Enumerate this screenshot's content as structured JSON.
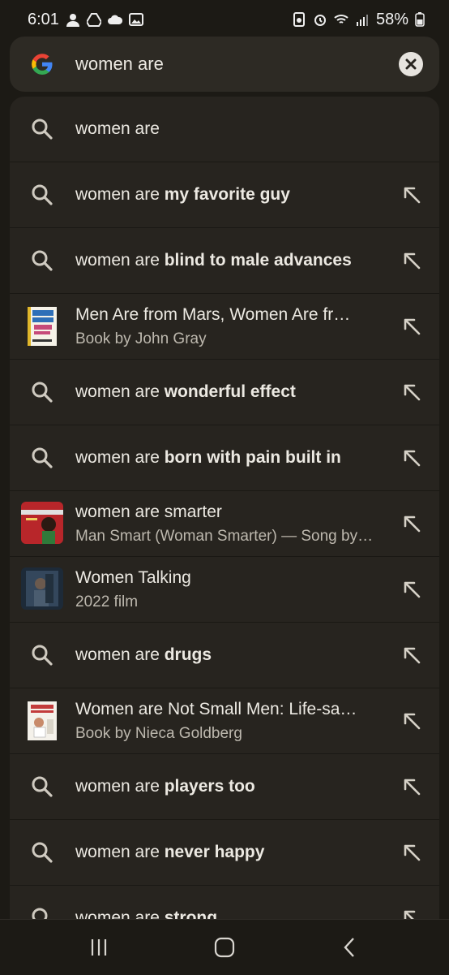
{
  "status_bar": {
    "time": "6:01",
    "battery": "58%",
    "icons_left": [
      "account-icon",
      "drive-icon",
      "cloud-upload-icon",
      "image-icon"
    ],
    "icons_right": [
      "recycle-icon",
      "alarm-icon",
      "wifi-icon",
      "signal-icon",
      "battery-icon"
    ]
  },
  "search": {
    "query": "women are"
  },
  "suggestions": [
    {
      "kind": "query",
      "prefix": "women are",
      "bold": "",
      "arrow": false
    },
    {
      "kind": "query",
      "prefix": "women are ",
      "bold": "my favorite guy",
      "arrow": true
    },
    {
      "kind": "query",
      "prefix": "women are ",
      "bold": "blind to male advances",
      "arrow": true
    },
    {
      "kind": "entity",
      "title": "Men Are from Mars, Women Are fr…",
      "subtitle": "Book by John Gray",
      "thumb": "book-cover-mars",
      "arrow": true
    },
    {
      "kind": "query",
      "prefix": "women are ",
      "bold": "wonderful effect",
      "arrow": true
    },
    {
      "kind": "query",
      "prefix": "women are ",
      "bold": "born with pain built in",
      "arrow": true
    },
    {
      "kind": "entity",
      "title": "women are smarter",
      "subtitle": "Man Smart (Woman Smarter) — Song by…",
      "thumb": "album-cover",
      "arrow": true
    },
    {
      "kind": "entity",
      "title": "Women Talking",
      "subtitle": "2022 film",
      "thumb": "film-poster",
      "arrow": true
    },
    {
      "kind": "query",
      "prefix": "women are ",
      "bold": "drugs",
      "arrow": true
    },
    {
      "kind": "entity",
      "title": "Women are Not Small Men: Life-sa…",
      "subtitle": "Book by Nieca Goldberg",
      "thumb": "book-cover-goldberg",
      "arrow": true
    },
    {
      "kind": "query",
      "prefix": "women are ",
      "bold": "players too",
      "arrow": true
    },
    {
      "kind": "query",
      "prefix": "women are ",
      "bold": "never happy",
      "arrow": true
    },
    {
      "kind": "query",
      "prefix": "women are ",
      "bold": "strong",
      "arrow": true
    }
  ],
  "nav": {
    "icons": [
      "recent-apps-icon",
      "home-icon",
      "back-icon"
    ]
  },
  "colors": {
    "background": "#1c1a15",
    "panel": "#27241f",
    "search_bar": "#2d2a24",
    "text": "#ece9e2",
    "subtext": "#bdb8ae"
  }
}
